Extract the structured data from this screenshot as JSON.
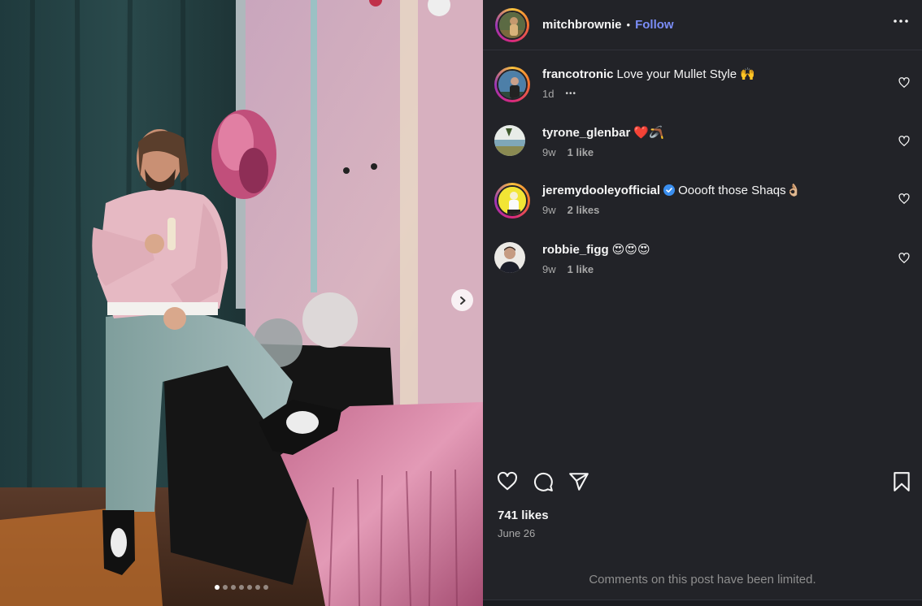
{
  "post": {
    "author": "mitchbrownie",
    "separator": "•",
    "follow_label": "Follow",
    "carousel": {
      "slide_count": 7,
      "active_index": 0
    }
  },
  "comments": [
    {
      "username": "francotronic",
      "text": "Love your Mullet Style 🙌",
      "time": "1d",
      "likes": "",
      "verified": false,
      "more": "•••"
    },
    {
      "username": "tyrone_glenbar",
      "text": "❤️🪃",
      "time": "9w",
      "likes": "1 like",
      "verified": false
    },
    {
      "username": "jeremydooleyofficial",
      "text": "Ooooft those Shaqs👌🏼",
      "time": "9w",
      "likes": "2 likes",
      "verified": true
    },
    {
      "username": "robbie_figg",
      "text": "😍😍😍",
      "time": "9w",
      "likes": "1 like",
      "verified": false
    }
  ],
  "stats": {
    "likes": "741 likes",
    "date": "June 26"
  },
  "notice": "Comments on this post have been limited.",
  "icons": {
    "header_more": "more-horizontal-icon",
    "next": "chevron-right-icon",
    "like": "heart-icon",
    "comment": "comment-icon",
    "share": "send-icon",
    "save": "bookmark-icon"
  },
  "colors": {
    "panel_bg": "#222328",
    "follow_link": "#7b8df7",
    "muted_text": "#a8a8a8"
  }
}
